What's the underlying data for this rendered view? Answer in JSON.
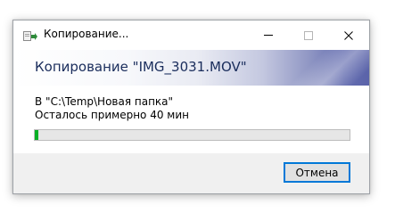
{
  "window": {
    "title": "Копирование...",
    "icon": "copy-files-icon",
    "controls": {
      "minimize_icon": "minimize-icon",
      "maximize_icon": "maximize-icon",
      "close_icon": "close-icon"
    }
  },
  "banner": {
    "text": "Копирование \"IMG_3031.MOV\""
  },
  "info": {
    "destination": "В \"C:\\Temp\\Новая папка\"",
    "time_remaining": "Осталось примерно 40 мин"
  },
  "progress": {
    "fraction": 0.01,
    "color": "#06b025"
  },
  "buttons": {
    "cancel_label": "Отмена"
  },
  "colors": {
    "accent": "#0078d7",
    "banner_text": "#1a2d5c"
  }
}
